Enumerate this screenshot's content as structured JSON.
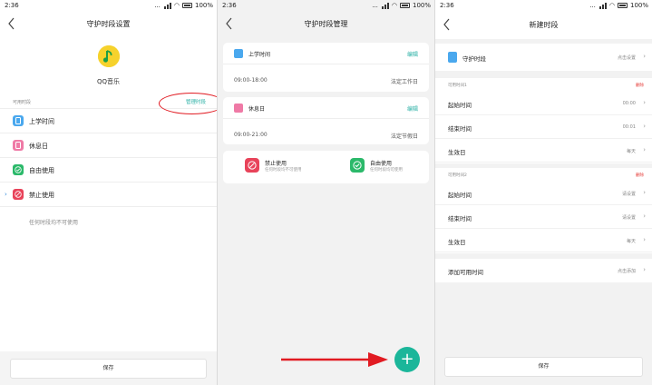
{
  "status_bar": {
    "time": "2:36",
    "dots": "...",
    "battery": "100%"
  },
  "panel1": {
    "title": "守护时段设置",
    "app_name": "QQ音乐",
    "section_label": "可用时段",
    "manage_label": "管理时段",
    "items": [
      {
        "label": "上学时间",
        "icon": "phone-icon",
        "color": "#4aa8ee"
      },
      {
        "label": "休息日",
        "icon": "phone-icon",
        "color": "#ef7aa6"
      },
      {
        "label": "自由使用",
        "icon": "check-circle-icon",
        "color": "#2bb96a"
      },
      {
        "label": "禁止使用",
        "icon": "forbidden-icon",
        "color": "#e8435a"
      }
    ],
    "selected_marker": "›",
    "hint": "任何时段均不可使用",
    "save_label": "保存"
  },
  "panel2": {
    "title": "守护时段管理",
    "cards": [
      {
        "name": "上学时间",
        "edit": "编辑",
        "range": "09:00-18:00",
        "tag": "法定工作日",
        "color": "#4aa8ee"
      },
      {
        "name": "休息日",
        "edit": "编辑",
        "range": "09:00-21:00",
        "tag": "法定节假日",
        "color": "#ef7aa6"
      }
    ],
    "options": [
      {
        "title": "禁止使用",
        "sub": "任何时段均不可使用",
        "color": "#e8435a"
      },
      {
        "title": "自由使用",
        "sub": "任何时段均可使用",
        "color": "#2bb96a"
      }
    ],
    "fab_symbol": "+"
  },
  "panel3": {
    "title": "新建时段",
    "guard_label": "守护时段",
    "guard_value": "点击设置",
    "group1": {
      "label": "可用时间1",
      "delete": "删除",
      "rows": [
        {
          "label": "起始时间",
          "value": "00:00"
        },
        {
          "label": "结束时间",
          "value": "00:01"
        },
        {
          "label": "生效日",
          "value": "每天"
        }
      ]
    },
    "group2": {
      "label": "可用时间2",
      "delete": "删除",
      "rows": [
        {
          "label": "起始时间",
          "value": "请设置"
        },
        {
          "label": "结束时间",
          "value": "请设置"
        },
        {
          "label": "生效日",
          "value": "每天"
        }
      ]
    },
    "add_label": "添加可用时间",
    "add_value": "点击添加",
    "save_label": "保存"
  },
  "colors": {
    "accent": "#2ab0a5",
    "fab": "#1bb69a",
    "danger": "#e53935",
    "annotation": "#e11b22"
  }
}
